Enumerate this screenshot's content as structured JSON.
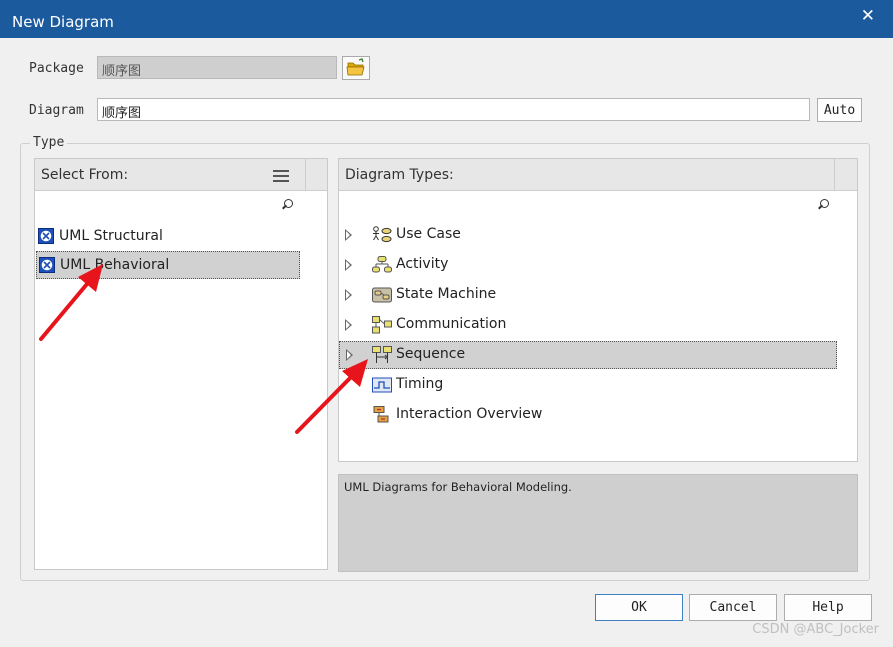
{
  "window": {
    "title": "New Diagram",
    "close_glyph": "✕"
  },
  "form": {
    "package_label": "Package",
    "package_value": "顺序图",
    "diagram_label": "Diagram",
    "diagram_value": "顺序图",
    "auto_label": "Auto"
  },
  "type_group": {
    "label": "Type"
  },
  "select_from": {
    "header": "Select From:",
    "items": [
      {
        "label": "UML Structural",
        "selected": false
      },
      {
        "label": "UML Behavioral",
        "selected": true
      }
    ]
  },
  "diagram_types": {
    "header": "Diagram Types:",
    "items": [
      {
        "label": "Use Case",
        "icon": "use-case-icon",
        "expandable": true
      },
      {
        "label": "Activity",
        "icon": "activity-icon",
        "expandable": true
      },
      {
        "label": "State Machine",
        "icon": "state-machine-icon",
        "expandable": true
      },
      {
        "label": "Communication",
        "icon": "communication-icon",
        "expandable": true
      },
      {
        "label": "Sequence",
        "icon": "sequence-icon",
        "expandable": true,
        "selected": true
      },
      {
        "label": "Timing",
        "icon": "timing-icon",
        "expandable": false
      },
      {
        "label": "Interaction Overview",
        "icon": "interaction-overview-icon",
        "expandable": false
      }
    ]
  },
  "description": "UML Diagrams for Behavioral Modeling.",
  "buttons": {
    "ok": "OK",
    "cancel": "Cancel",
    "help": "Help"
  },
  "watermark": "CSDN @ABC_Jocker",
  "colors": {
    "titlebar": "#1b5a9c",
    "selection": "#d1d1d1",
    "annotation_arrow": "#e8141b"
  }
}
